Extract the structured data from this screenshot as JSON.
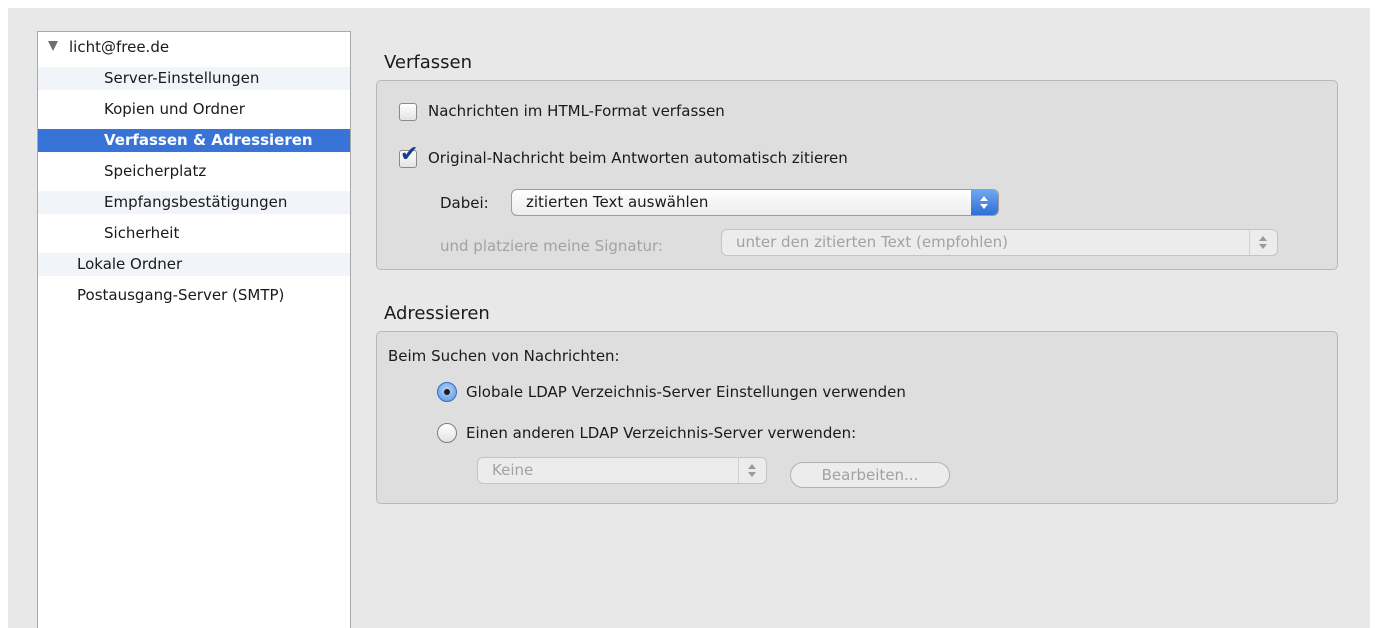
{
  "sidebar": {
    "account": "licht@free.de",
    "items": [
      {
        "label": "Server-Einstellungen"
      },
      {
        "label": "Kopien und Ordner"
      },
      {
        "label": "Verfassen & Adressieren"
      },
      {
        "label": "Speicherplatz"
      },
      {
        "label": "Empfangsbestätigungen"
      },
      {
        "label": "Sicherheit"
      }
    ],
    "local_folders": "Lokale Ordner",
    "smtp": "Postausgang-Server (SMTP)",
    "selected_index": 2
  },
  "compose": {
    "title": "Verfassen",
    "html_format_label": "Nachrichten im HTML-Format verfassen",
    "html_format_checked": false,
    "quote_label": "Original-Nachricht beim Antworten automatisch zitieren",
    "quote_checked": true,
    "dabei_label": "Dabei:",
    "dabei_value": "zitierten Text auswählen",
    "signature_label": "und platziere meine Signatur:",
    "signature_value": "unter den zitierten Text (empfohlen)"
  },
  "addressing": {
    "title": "Adressieren",
    "search_label": "Beim Suchen von Nachrichten:",
    "radio_global": "Globale LDAP Verzeichnis-Server Einstellungen verwenden",
    "radio_other": "Einen anderen LDAP Verzeichnis-Server verwenden:",
    "selected_radio": "global",
    "directory_value": "Keine",
    "edit_button": "Bearbeiten..."
  },
  "colors": {
    "selection": "#3874d8",
    "background": "#e8e8e8",
    "group_box": "#dedede"
  }
}
